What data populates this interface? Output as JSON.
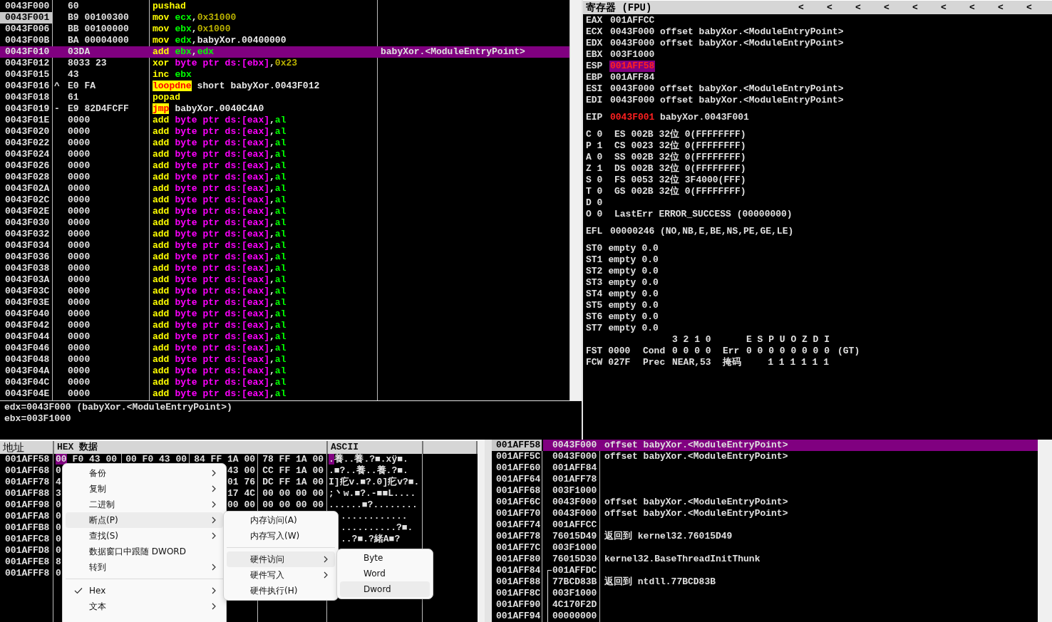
{
  "disassembly": {
    "rows": [
      {
        "address": "0043F000",
        "current": false,
        "selected": false,
        "bytes": "60",
        "instruction": [
          {
            "kind": "mnemonic",
            "text": "pushad"
          }
        ]
      },
      {
        "address": "0043F001",
        "current": true,
        "selected": false,
        "bytes": "B9 00100300",
        "instruction": [
          {
            "kind": "mnemonic",
            "text": "mov"
          },
          {
            "kind": "register",
            "text": "ecx"
          },
          {
            "kind": "punct",
            "text": ","
          },
          {
            "kind": "number",
            "text": "0x31000"
          }
        ]
      },
      {
        "address": "0043F006",
        "current": false,
        "selected": false,
        "bytes": "BB 00100000",
        "instruction": [
          {
            "kind": "mnemonic",
            "text": "mov"
          },
          {
            "kind": "register",
            "text": "ebx"
          },
          {
            "kind": "punct",
            "text": ","
          },
          {
            "kind": "number",
            "text": "0x1000"
          }
        ]
      },
      {
        "address": "0043F00B",
        "current": false,
        "selected": false,
        "bytes": "BA 00004000",
        "instruction": [
          {
            "kind": "mnemonic",
            "text": "mov"
          },
          {
            "kind": "register",
            "text": "edx"
          },
          {
            "kind": "punct",
            "text": ","
          },
          {
            "kind": "symbol",
            "text": "babyXor.00400000"
          }
        ]
      },
      {
        "address": "0043F010",
        "current": false,
        "selected": true,
        "bytes": "03DA",
        "instruction": [
          {
            "kind": "mnemonic",
            "text": "add"
          },
          {
            "kind": "register",
            "text": "ebx"
          },
          {
            "kind": "punct",
            "text": ","
          },
          {
            "kind": "register",
            "text": "edx"
          }
        ],
        "comment": "babyXor.<ModuleEntryPoint>"
      },
      {
        "address": "0043F012",
        "current": false,
        "selected": false,
        "bytes": "8033 23",
        "instruction": [
          {
            "kind": "mnemonic",
            "text": "xor"
          },
          {
            "kind": "memory",
            "text": "byte ptr ds:[ebx]"
          },
          {
            "kind": "punct",
            "text": ","
          },
          {
            "kind": "number",
            "text": "0x23"
          }
        ]
      },
      {
        "address": "0043F015",
        "current": false,
        "selected": false,
        "bytes": "43",
        "instruction": [
          {
            "kind": "mnemonic",
            "text": "inc"
          },
          {
            "kind": "register",
            "text": "ebx"
          }
        ]
      },
      {
        "address": "0043F016",
        "current": false,
        "selected": false,
        "mark": "^",
        "bytes": "E0 FA",
        "instruction": [
          {
            "kind": "jump",
            "text": "loopdne"
          },
          {
            "kind": "symbol",
            "text": "short babyXor.0043F012"
          }
        ]
      },
      {
        "address": "0043F018",
        "current": false,
        "selected": false,
        "bytes": "61",
        "instruction": [
          {
            "kind": "mnemonic",
            "text": "popad"
          }
        ]
      },
      {
        "address": "0043F019",
        "current": false,
        "selected": false,
        "mark": "-",
        "bytes": "E9 82D4FCFF",
        "instruction": [
          {
            "kind": "jump",
            "text": "jmp"
          },
          {
            "kind": "symbol",
            "text": "babyXor.0040C4A0"
          }
        ]
      },
      {
        "address": "0043F01E",
        "current": false,
        "selected": false,
        "bytes": "0000",
        "instruction": [
          {
            "kind": "mnemonic",
            "text": "add"
          },
          {
            "kind": "memory",
            "text": "byte ptr ds:[eax]"
          },
          {
            "kind": "punct",
            "text": ","
          },
          {
            "kind": "register",
            "text": "al"
          }
        ]
      },
      {
        "address": "0043F020",
        "current": false,
        "selected": false,
        "bytes": "0000",
        "instruction": [
          {
            "kind": "mnemonic",
            "text": "add"
          },
          {
            "kind": "memory",
            "text": "byte ptr ds:[eax]"
          },
          {
            "kind": "punct",
            "text": ","
          },
          {
            "kind": "register",
            "text": "al"
          }
        ]
      },
      {
        "address": "0043F022",
        "current": false,
        "selected": false,
        "bytes": "0000",
        "instruction": [
          {
            "kind": "mnemonic",
            "text": "add"
          },
          {
            "kind": "memory",
            "text": "byte ptr ds:[eax]"
          },
          {
            "kind": "punct",
            "text": ","
          },
          {
            "kind": "register",
            "text": "al"
          }
        ]
      },
      {
        "address": "0043F024",
        "current": false,
        "selected": false,
        "bytes": "0000",
        "instruction": [
          {
            "kind": "mnemonic",
            "text": "add"
          },
          {
            "kind": "memory",
            "text": "byte ptr ds:[eax]"
          },
          {
            "kind": "punct",
            "text": ","
          },
          {
            "kind": "register",
            "text": "al"
          }
        ]
      },
      {
        "address": "0043F026",
        "current": false,
        "selected": false,
        "bytes": "0000",
        "instruction": [
          {
            "kind": "mnemonic",
            "text": "add"
          },
          {
            "kind": "memory",
            "text": "byte ptr ds:[eax]"
          },
          {
            "kind": "punct",
            "text": ","
          },
          {
            "kind": "register",
            "text": "al"
          }
        ]
      },
      {
        "address": "0043F028",
        "current": false,
        "selected": false,
        "bytes": "0000",
        "instruction": [
          {
            "kind": "mnemonic",
            "text": "add"
          },
          {
            "kind": "memory",
            "text": "byte ptr ds:[eax]"
          },
          {
            "kind": "punct",
            "text": ","
          },
          {
            "kind": "register",
            "text": "al"
          }
        ]
      },
      {
        "address": "0043F02A",
        "current": false,
        "selected": false,
        "bytes": "0000",
        "instruction": [
          {
            "kind": "mnemonic",
            "text": "add"
          },
          {
            "kind": "memory",
            "text": "byte ptr ds:[eax]"
          },
          {
            "kind": "punct",
            "text": ","
          },
          {
            "kind": "register",
            "text": "al"
          }
        ]
      },
      {
        "address": "0043F02C",
        "current": false,
        "selected": false,
        "bytes": "0000",
        "instruction": [
          {
            "kind": "mnemonic",
            "text": "add"
          },
          {
            "kind": "memory",
            "text": "byte ptr ds:[eax]"
          },
          {
            "kind": "punct",
            "text": ","
          },
          {
            "kind": "register",
            "text": "al"
          }
        ]
      },
      {
        "address": "0043F02E",
        "current": false,
        "selected": false,
        "bytes": "0000",
        "instruction": [
          {
            "kind": "mnemonic",
            "text": "add"
          },
          {
            "kind": "memory",
            "text": "byte ptr ds:[eax]"
          },
          {
            "kind": "punct",
            "text": ","
          },
          {
            "kind": "register",
            "text": "al"
          }
        ]
      },
      {
        "address": "0043F030",
        "current": false,
        "selected": false,
        "bytes": "0000",
        "instruction": [
          {
            "kind": "mnemonic",
            "text": "add"
          },
          {
            "kind": "memory",
            "text": "byte ptr ds:[eax]"
          },
          {
            "kind": "punct",
            "text": ","
          },
          {
            "kind": "register",
            "text": "al"
          }
        ]
      },
      {
        "address": "0043F032",
        "current": false,
        "selected": false,
        "bytes": "0000",
        "instruction": [
          {
            "kind": "mnemonic",
            "text": "add"
          },
          {
            "kind": "memory",
            "text": "byte ptr ds:[eax]"
          },
          {
            "kind": "punct",
            "text": ","
          },
          {
            "kind": "register",
            "text": "al"
          }
        ]
      },
      {
        "address": "0043F034",
        "current": false,
        "selected": false,
        "bytes": "0000",
        "instruction": [
          {
            "kind": "mnemonic",
            "text": "add"
          },
          {
            "kind": "memory",
            "text": "byte ptr ds:[eax]"
          },
          {
            "kind": "punct",
            "text": ","
          },
          {
            "kind": "register",
            "text": "al"
          }
        ]
      },
      {
        "address": "0043F036",
        "current": false,
        "selected": false,
        "bytes": "0000",
        "instruction": [
          {
            "kind": "mnemonic",
            "text": "add"
          },
          {
            "kind": "memory",
            "text": "byte ptr ds:[eax]"
          },
          {
            "kind": "punct",
            "text": ","
          },
          {
            "kind": "register",
            "text": "al"
          }
        ]
      },
      {
        "address": "0043F038",
        "current": false,
        "selected": false,
        "bytes": "0000",
        "instruction": [
          {
            "kind": "mnemonic",
            "text": "add"
          },
          {
            "kind": "memory",
            "text": "byte ptr ds:[eax]"
          },
          {
            "kind": "punct",
            "text": ","
          },
          {
            "kind": "register",
            "text": "al"
          }
        ]
      },
      {
        "address": "0043F03A",
        "current": false,
        "selected": false,
        "bytes": "0000",
        "instruction": [
          {
            "kind": "mnemonic",
            "text": "add"
          },
          {
            "kind": "memory",
            "text": "byte ptr ds:[eax]"
          },
          {
            "kind": "punct",
            "text": ","
          },
          {
            "kind": "register",
            "text": "al"
          }
        ]
      },
      {
        "address": "0043F03C",
        "current": false,
        "selected": false,
        "bytes": "0000",
        "instruction": [
          {
            "kind": "mnemonic",
            "text": "add"
          },
          {
            "kind": "memory",
            "text": "byte ptr ds:[eax]"
          },
          {
            "kind": "punct",
            "text": ","
          },
          {
            "kind": "register",
            "text": "al"
          }
        ]
      },
      {
        "address": "0043F03E",
        "current": false,
        "selected": false,
        "bytes": "0000",
        "instruction": [
          {
            "kind": "mnemonic",
            "text": "add"
          },
          {
            "kind": "memory",
            "text": "byte ptr ds:[eax]"
          },
          {
            "kind": "punct",
            "text": ","
          },
          {
            "kind": "register",
            "text": "al"
          }
        ]
      },
      {
        "address": "0043F040",
        "current": false,
        "selected": false,
        "bytes": "0000",
        "instruction": [
          {
            "kind": "mnemonic",
            "text": "add"
          },
          {
            "kind": "memory",
            "text": "byte ptr ds:[eax]"
          },
          {
            "kind": "punct",
            "text": ","
          },
          {
            "kind": "register",
            "text": "al"
          }
        ]
      },
      {
        "address": "0043F042",
        "current": false,
        "selected": false,
        "bytes": "0000",
        "instruction": [
          {
            "kind": "mnemonic",
            "text": "add"
          },
          {
            "kind": "memory",
            "text": "byte ptr ds:[eax]"
          },
          {
            "kind": "punct",
            "text": ","
          },
          {
            "kind": "register",
            "text": "al"
          }
        ]
      },
      {
        "address": "0043F044",
        "current": false,
        "selected": false,
        "bytes": "0000",
        "instruction": [
          {
            "kind": "mnemonic",
            "text": "add"
          },
          {
            "kind": "memory",
            "text": "byte ptr ds:[eax]"
          },
          {
            "kind": "punct",
            "text": ","
          },
          {
            "kind": "register",
            "text": "al"
          }
        ]
      },
      {
        "address": "0043F046",
        "current": false,
        "selected": false,
        "bytes": "0000",
        "instruction": [
          {
            "kind": "mnemonic",
            "text": "add"
          },
          {
            "kind": "memory",
            "text": "byte ptr ds:[eax]"
          },
          {
            "kind": "punct",
            "text": ","
          },
          {
            "kind": "register",
            "text": "al"
          }
        ]
      },
      {
        "address": "0043F048",
        "current": false,
        "selected": false,
        "bytes": "0000",
        "instruction": [
          {
            "kind": "mnemonic",
            "text": "add"
          },
          {
            "kind": "memory",
            "text": "byte ptr ds:[eax]"
          },
          {
            "kind": "punct",
            "text": ","
          },
          {
            "kind": "register",
            "text": "al"
          }
        ]
      },
      {
        "address": "0043F04A",
        "current": false,
        "selected": false,
        "bytes": "0000",
        "instruction": [
          {
            "kind": "mnemonic",
            "text": "add"
          },
          {
            "kind": "memory",
            "text": "byte ptr ds:[eax]"
          },
          {
            "kind": "punct",
            "text": ","
          },
          {
            "kind": "register",
            "text": "al"
          }
        ]
      },
      {
        "address": "0043F04C",
        "current": false,
        "selected": false,
        "bytes": "0000",
        "instruction": [
          {
            "kind": "mnemonic",
            "text": "add"
          },
          {
            "kind": "memory",
            "text": "byte ptr ds:[eax]"
          },
          {
            "kind": "punct",
            "text": ","
          },
          {
            "kind": "register",
            "text": "al"
          }
        ]
      },
      {
        "address": "0043F04E",
        "current": false,
        "selected": false,
        "bytes": "0000",
        "instruction": [
          {
            "kind": "mnemonic",
            "text": "add"
          },
          {
            "kind": "memory",
            "text": "byte ptr ds:[eax]"
          },
          {
            "kind": "punct",
            "text": ","
          },
          {
            "kind": "register",
            "text": "al"
          }
        ]
      }
    ]
  },
  "info": {
    "lines": [
      "edx=0043F000 (babyXor.<ModuleEntryPoint>)",
      "ebx=003F1000"
    ]
  },
  "registers": {
    "title": "寄存器 (FPU)",
    "arrows": [
      "<",
      "<",
      "<",
      "<",
      "<",
      "<",
      "<",
      "<",
      "<"
    ],
    "general": [
      {
        "name": "EAX",
        "value": "001AFFCC",
        "changed": false,
        "selected": false
      },
      {
        "name": "ECX",
        "value": "0043F000",
        "changed": false,
        "selected": false,
        "comment": "offset babyXor.<ModuleEntryPoint>"
      },
      {
        "name": "EDX",
        "value": "0043F000",
        "changed": false,
        "selected": false,
        "comment": "offset babyXor.<ModuleEntryPoint>"
      },
      {
        "name": "EBX",
        "value": "003F1000",
        "changed": false,
        "selected": false
      },
      {
        "name": "ESP",
        "value": "001AFF58",
        "changed": true,
        "selected": true
      },
      {
        "name": "EBP",
        "value": "001AFF84",
        "changed": false,
        "selected": false
      },
      {
        "name": "ESI",
        "value": "0043F000",
        "changed": false,
        "selected": false,
        "comment": "offset babyXor.<ModuleEntryPoint>"
      },
      {
        "name": "EDI",
        "value": "0043F000",
        "changed": false,
        "selected": false,
        "comment": "offset babyXor.<ModuleEntryPoint>"
      }
    ],
    "eip": {
      "name": "EIP",
      "value": "0043F001",
      "changed": true,
      "selected": false,
      "comment": "babyXor.0043F001"
    },
    "flags": [
      {
        "flag": "C 0",
        "detail": "ES 002B 32位 0(FFFFFFFF)"
      },
      {
        "flag": "P 1",
        "detail": "CS 0023 32位 0(FFFFFFFF)"
      },
      {
        "flag": "A 0",
        "detail": "SS 002B 32位 0(FFFFFFFF)"
      },
      {
        "flag": "Z 1",
        "detail": "DS 002B 32位 0(FFFFFFFF)"
      },
      {
        "flag": "S 0",
        "detail": "FS 0053 32位 3F4000(FFF)"
      },
      {
        "flag": "T 0",
        "detail": "GS 002B 32位 0(FFFFFFFF)"
      },
      {
        "flag": "D 0"
      },
      {
        "flag": "O 0",
        "detail": "LastErr ERROR_SUCCESS (00000000)"
      }
    ],
    "efl": {
      "name": "EFL",
      "value": "00000246",
      "detail": "(NO,NB,E,BE,NS,PE,GE,LE)"
    },
    "fpu_stack": [
      {
        "name": "ST0",
        "tag": "empty",
        "value": "0.0"
      },
      {
        "name": "ST1",
        "tag": "empty",
        "value": "0.0"
      },
      {
        "name": "ST2",
        "tag": "empty",
        "value": "0.0"
      },
      {
        "name": "ST3",
        "tag": "empty",
        "value": "0.0"
      },
      {
        "name": "ST4",
        "tag": "empty",
        "value": "0.0"
      },
      {
        "name": "ST5",
        "tag": "empty",
        "value": "0.0"
      },
      {
        "name": "ST6",
        "tag": "empty",
        "value": "0.0"
      },
      {
        "name": "ST7",
        "tag": "empty",
        "value": "0.0"
      }
    ],
    "fpu_status": [
      {
        "column_3": "3 2 1 0",
        "column_5": "E S P U O Z D I"
      },
      {
        "column_1": "FST 0000",
        "column_2": "Cond",
        "column_3": "0 0 0 0",
        "column_4": "Err",
        "column_5": "0 0 0 0 0 0 0 0",
        "column_6": "(GT)"
      },
      {
        "column_1": "FCW 027F",
        "column_2": "Prec",
        "column_3": "NEAR,53",
        "column_4": "掩码",
        "column_5": "1 1 1 1 1 1"
      }
    ]
  },
  "dump": {
    "columns": [
      "地址",
      "HEX 数据",
      "ASCII"
    ],
    "rows": [
      {
        "address": "001AFF58",
        "cursor_byte": "00",
        "hex_1": "F0 43 00",
        "hex_2": "00 F0 43 00",
        "hex_3": "84 FF 1A 00",
        "hex_4": "78 FF 1A 00",
        "cursor_char": ".",
        "ascii": "養..養.?■.xÿ■."
      },
      {
        "address": "001AFF68",
        "hex_1": "0",
        "hex_3": "43 00",
        "hex_4": "CC FF 1A 00",
        "ascii": ".■?..養..養.?■."
      },
      {
        "address": "001AFF78",
        "hex_1": "4",
        "hex_3": "01 76",
        "hex_4": "DC FF 1A 00",
        "ascii": "I]疕v.■?.0]疕v?■."
      },
      {
        "address": "001AFF88",
        "hex_1": "3",
        "hex_3": "17 4C",
        "hex_4": "00 00 00 00",
        "ascii": ";丶w.■?.-■■L...."
      },
      {
        "address": "001AFF98",
        "hex_1": "0",
        "hex_3": "00 00",
        "hex_4": "00 00 00 00",
        "ascii": "......■?........"
      },
      {
        "address": "001AFFA8",
        "hex_1": "0",
        "ascii": "............"
      },
      {
        "address": "001AFFB8",
        "hex_1": "0",
        "ascii": "..........?■."
      },
      {
        "address": "001AFFC8",
        "hex_1": "0",
        "ascii": "..?■.?緒A■?"
      },
      {
        "address": "001AFFD8",
        "hex_1": "0"
      },
      {
        "address": "001AFFE8",
        "hex_1": "8"
      },
      {
        "address": "001AFFF8",
        "hex_1": "0"
      }
    ]
  },
  "stack": {
    "rows": [
      {
        "address": "001AFF58",
        "value": "0043F000",
        "selected": true,
        "comment": "offset babyXor.<ModuleEntryPoint>"
      },
      {
        "address": "001AFF5C",
        "value": "0043F000",
        "selected": false,
        "comment": "offset babyXor.<ModuleEntryPoint>"
      },
      {
        "address": "001AFF60",
        "value": "001AFF84",
        "selected": false
      },
      {
        "address": "001AFF64",
        "value": "001AFF78",
        "selected": false
      },
      {
        "address": "001AFF68",
        "value": "003F1000",
        "selected": false
      },
      {
        "address": "001AFF6C",
        "value": "0043F000",
        "selected": false,
        "comment": "offset babyXor.<ModuleEntryPoint>"
      },
      {
        "address": "001AFF70",
        "value": "0043F000",
        "selected": false,
        "comment": "offset babyXor.<ModuleEntryPoint>"
      },
      {
        "address": "001AFF74",
        "value": "001AFFCC",
        "selected": false
      },
      {
        "address": "001AFF78",
        "value": "76015D49",
        "selected": false,
        "comment": "返回到 kernel32.76015D49"
      },
      {
        "address": "001AFF7C",
        "value": "003F1000",
        "selected": false
      },
      {
        "address": "001AFF80",
        "value": "76015D30",
        "selected": false,
        "comment": "kernel32.BaseThreadInitThunk"
      },
      {
        "address": "001AFF84",
        "value": "001AFFDC",
        "selected": false,
        "frame_start": true,
        "in_frame": true
      },
      {
        "address": "001AFF88",
        "value": "77BCD83B",
        "selected": false,
        "frame_start": false,
        "in_frame": true,
        "comment": "返回到 ntdll.77BCD83B"
      },
      {
        "address": "001AFF8C",
        "value": "003F1000",
        "selected": false,
        "frame_start": false,
        "in_frame": true
      },
      {
        "address": "001AFF90",
        "value": "4C170F2D",
        "selected": false,
        "frame_start": false,
        "in_frame": true
      },
      {
        "address": "001AFF94",
        "value": "00000000",
        "selected": false,
        "frame_start": false,
        "in_frame": true
      }
    ]
  },
  "context_menu": {
    "items": [
      {
        "kind": "submenu",
        "label": "备份",
        "selected": false,
        "checked": false
      },
      {
        "kind": "submenu",
        "label": "复制",
        "selected": false,
        "checked": false
      },
      {
        "kind": "submenu",
        "label": "二进制",
        "selected": false,
        "checked": false
      },
      {
        "kind": "submenu",
        "label": "断点(P)",
        "selected": true,
        "checked": false
      },
      {
        "kind": "submenu",
        "label": "查找(S)",
        "selected": false,
        "checked": false
      },
      {
        "kind": "action",
        "label": "数据窗口中跟随 DWORD",
        "selected": false,
        "checked": false
      },
      {
        "kind": "submenu",
        "label": "转到",
        "selected": false,
        "checked": false
      },
      {
        "kind": "separator"
      },
      {
        "kind": "submenu",
        "label": "Hex",
        "selected": false,
        "checked": true
      },
      {
        "kind": "submenu",
        "label": "文本",
        "selected": false,
        "checked": false
      }
    ],
    "submenus": [
      {
        "items": [
          {
            "kind": "action",
            "label": "内存访问(A)",
            "selected": false
          },
          {
            "kind": "action",
            "label": "内存写入(W)",
            "selected": false
          },
          {
            "kind": "separator"
          },
          {
            "kind": "submenu",
            "label": "硬件访问",
            "selected": true
          },
          {
            "kind": "submenu",
            "label": "硬件写入",
            "selected": false
          },
          {
            "kind": "action",
            "label": "硬件执行(H)",
            "selected": false
          }
        ]
      },
      {
        "items": [
          {
            "kind": "action",
            "label": "Byte",
            "selected": false
          },
          {
            "kind": "action",
            "label": "Word",
            "selected": false
          },
          {
            "kind": "action",
            "label": "Dword",
            "selected": true
          }
        ]
      }
    ]
  }
}
